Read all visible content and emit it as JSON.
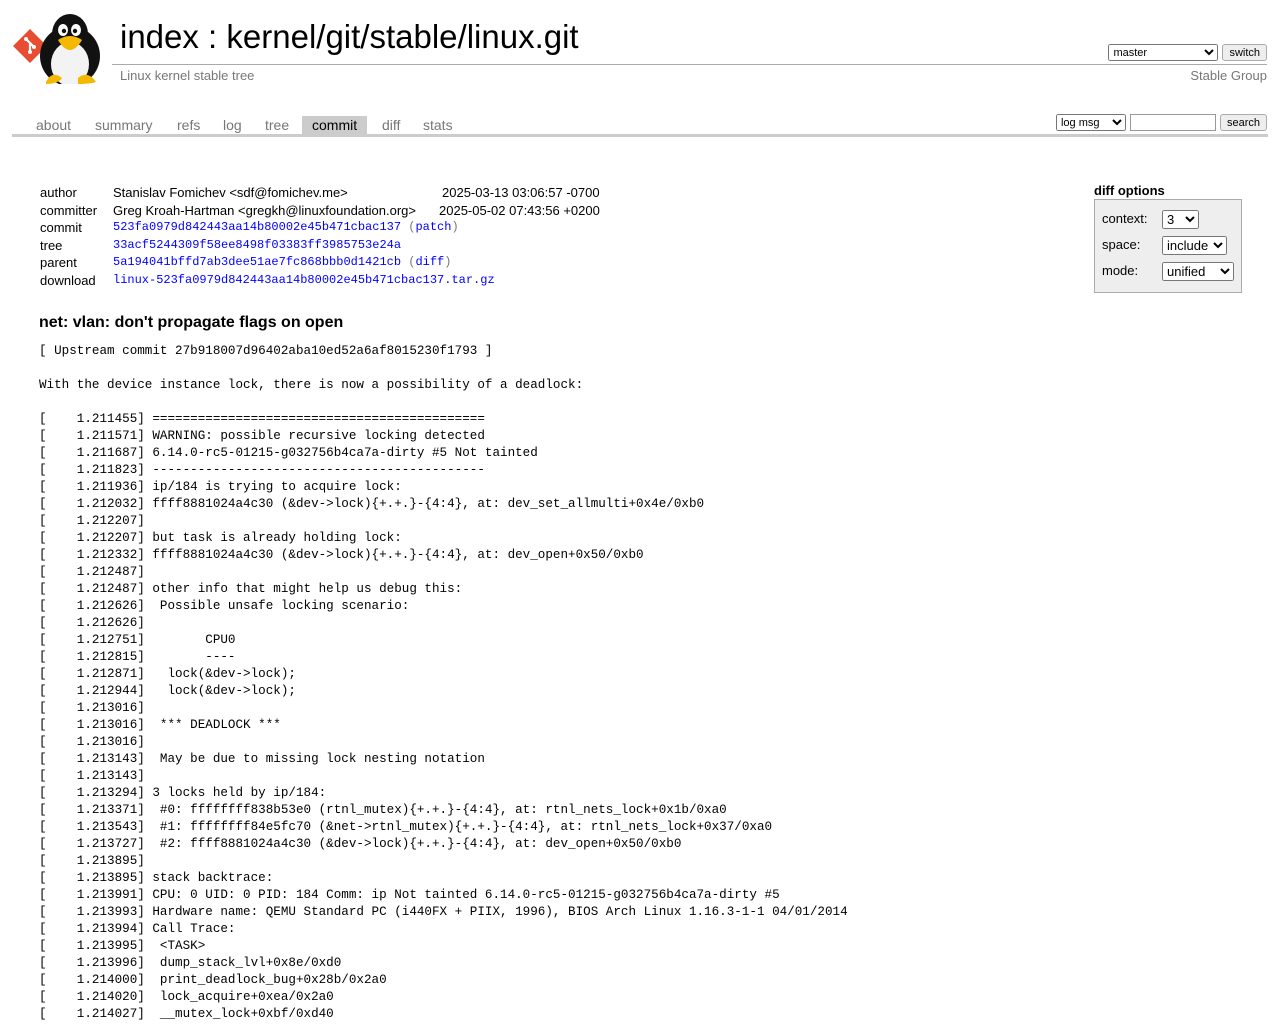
{
  "header": {
    "title_index": "index",
    "title_sep": " : ",
    "repo_path": "kernel/git/stable/linux.git",
    "description": "Linux kernel stable tree",
    "owner": "Stable Group",
    "branch_selected": "master",
    "switch_label": "switch"
  },
  "tabs": [
    "about",
    "summary",
    "refs",
    "log",
    "tree",
    "commit",
    "diff",
    "stats"
  ],
  "active_tab": "commit",
  "search": {
    "type_selected": "log msg",
    "query": "",
    "button_label": "search"
  },
  "commit_info": {
    "author_label": "author",
    "author": "Stanislav Fomichev <sdf@fomichev.me>",
    "author_date": "2025-03-13 03:06:57 -0700",
    "committer_label": "committer",
    "committer": "Greg Kroah-Hartman <gregkh@linuxfoundation.org>",
    "committer_date": "2025-05-02 07:43:56 +0200",
    "commit_label": "commit",
    "commit_hash": "523fa0979d842443aa14b80002e45b471cbac137",
    "patch_label": "patch",
    "tree_label": "tree",
    "tree_hash": "33acf5244309f58ee8498f03383ff3985753e24a",
    "parent_label": "parent",
    "parent_hash": "5a194041bffd7ab3dee51ae7fc868bbb0d1421cb",
    "diff_label": "diff",
    "download_label": "download",
    "download_file": "linux-523fa0979d842443aa14b80002e45b471cbac137.tar.gz"
  },
  "diff_options": {
    "header": "diff options",
    "context_label": "context:",
    "context_value": "3",
    "space_label": "space:",
    "space_value": "include",
    "mode_label": "mode:",
    "mode_value": "unified"
  },
  "subject": "net: vlan: don't propagate flags on open",
  "message_lines": [
    "[ Upstream commit 27b918007d96402aba10ed52a6af8015230f1793 ]",
    "",
    "With the device instance lock, there is now a possibility of a deadlock:",
    "",
    "[    1.211455] ============================================",
    "[    1.211571] WARNING: possible recursive locking detected",
    "[    1.211687] 6.14.0-rc5-01215-g032756b4ca7a-dirty #5 Not tainted",
    "[    1.211823] --------------------------------------------",
    "[    1.211936] ip/184 is trying to acquire lock:",
    "[    1.212032] ffff8881024a4c30 (&dev->lock){+.+.}-{4:4}, at: dev_set_allmulti+0x4e/0xb0",
    "[    1.212207]",
    "[    1.212207] but task is already holding lock:",
    "[    1.212332] ffff8881024a4c30 (&dev->lock){+.+.}-{4:4}, at: dev_open+0x50/0xb0",
    "[    1.212487]",
    "[    1.212487] other info that might help us debug this:",
    "[    1.212626]  Possible unsafe locking scenario:",
    "[    1.212626]",
    "[    1.212751]        CPU0",
    "[    1.212815]        ----",
    "[    1.212871]   lock(&dev->lock);",
    "[    1.212944]   lock(&dev->lock);",
    "[    1.213016]",
    "[    1.213016]  *** DEADLOCK ***",
    "[    1.213016]",
    "[    1.213143]  May be due to missing lock nesting notation",
    "[    1.213143]",
    "[    1.213294] 3 locks held by ip/184:",
    "[    1.213371]  #0: ffffffff838b53e0 (rtnl_mutex){+.+.}-{4:4}, at: rtnl_nets_lock+0x1b/0xa0",
    "[    1.213543]  #1: ffffffff84e5fc70 (&net->rtnl_mutex){+.+.}-{4:4}, at: rtnl_nets_lock+0x37/0xa0",
    "[    1.213727]  #2: ffff8881024a4c30 (&dev->lock){+.+.}-{4:4}, at: dev_open+0x50/0xb0",
    "[    1.213895]",
    "[    1.213895] stack backtrace:",
    "[    1.213991] CPU: 0 UID: 0 PID: 184 Comm: ip Not tainted 6.14.0-rc5-01215-g032756b4ca7a-dirty #5",
    "[    1.213993] Hardware name: QEMU Standard PC (i440FX + PIIX, 1996), BIOS Arch Linux 1.16.3-1-1 04/01/2014",
    "[    1.213994] Call Trace:",
    "[    1.213995]  <TASK>",
    "[    1.213996]  dump_stack_lvl+0x8e/0xd0",
    "[    1.214000]  print_deadlock_bug+0x28b/0x2a0",
    "[    1.214020]  lock_acquire+0xea/0x2a0",
    "[    1.214027]  __mutex_lock+0xbf/0xd40"
  ]
}
